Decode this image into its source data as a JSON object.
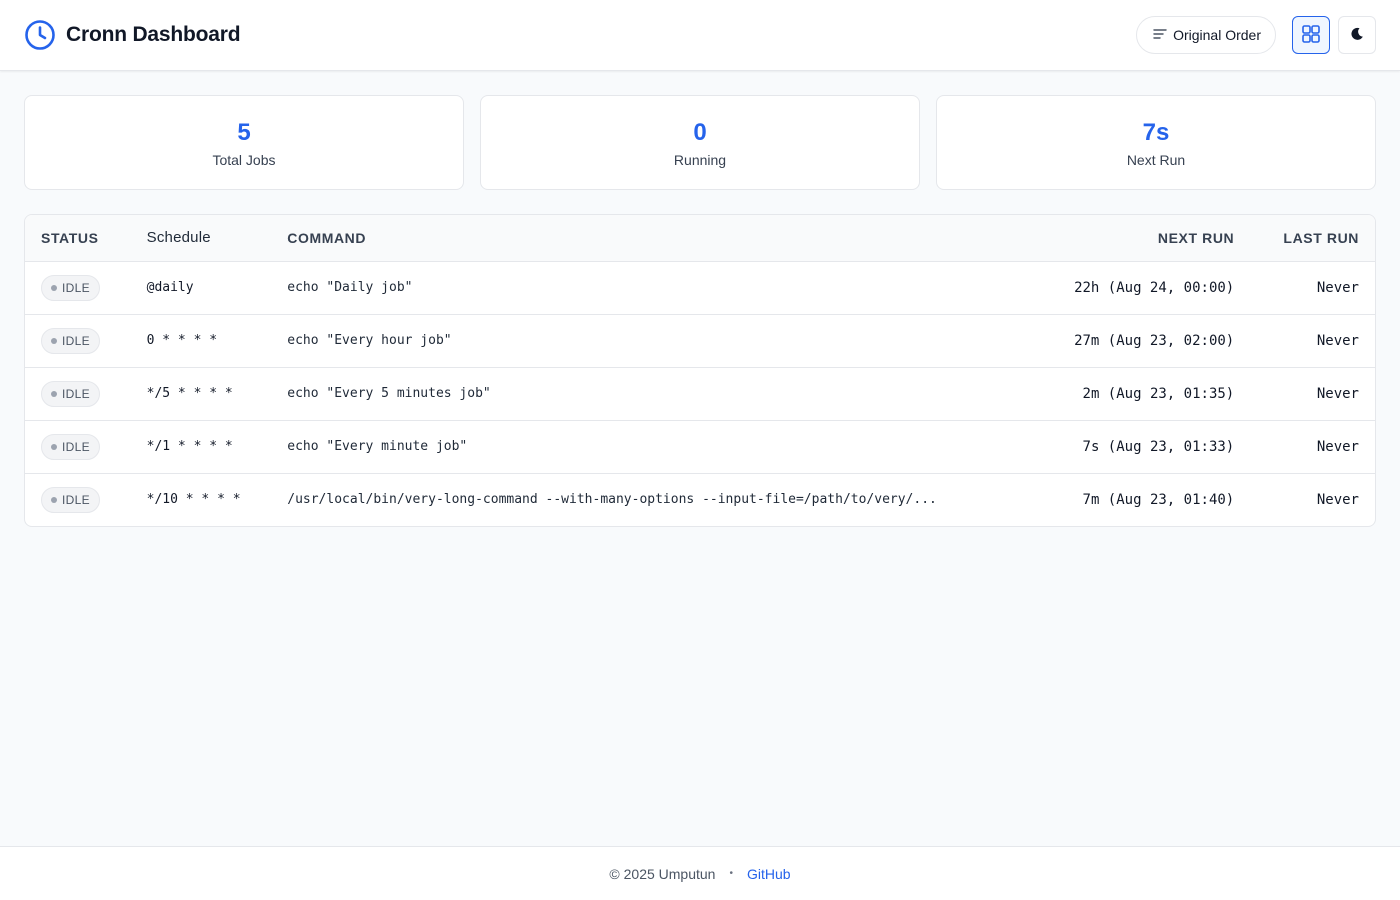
{
  "header": {
    "title": "Cronn Dashboard",
    "logo_icon": "clock-icon",
    "sort_label": "Original Order",
    "accent": "#2563eb"
  },
  "stats": [
    {
      "value": "5",
      "label": "Total Jobs"
    },
    {
      "value": "0",
      "label": "Running"
    },
    {
      "value": "7s",
      "label": "Next Run"
    }
  ],
  "table": {
    "headers": {
      "status": "STATUS",
      "schedule": "Schedule",
      "command": "COMMAND",
      "next_run": "NEXT RUN",
      "last_run": "LAST RUN"
    },
    "rows": [
      {
        "status": "IDLE",
        "schedule": "@daily",
        "command": "echo \"Daily job\"",
        "next_run": "22h (Aug 24, 00:00)",
        "last_run": "Never"
      },
      {
        "status": "IDLE",
        "schedule": "0 * * * *",
        "command": "echo \"Every hour job\"",
        "next_run": "27m (Aug 23, 02:00)",
        "last_run": "Never"
      },
      {
        "status": "IDLE",
        "schedule": "*/5 * * * *",
        "command": "echo \"Every 5 minutes job\"",
        "next_run": "2m (Aug 23, 01:35)",
        "last_run": "Never"
      },
      {
        "status": "IDLE",
        "schedule": "*/1 * * * *",
        "command": "echo \"Every minute job\"",
        "next_run": "7s (Aug 23, 01:33)",
        "last_run": "Never"
      },
      {
        "status": "IDLE",
        "schedule": "*/10 * * * *",
        "command": "/usr/local/bin/very-long-command --with-many-options --input-file=/path/to/very/...",
        "next_run": "7m (Aug 23, 01:40)",
        "last_run": "Never"
      }
    ]
  },
  "footer": {
    "copyright": "© 2025 Umputun",
    "separator": "•",
    "link_label": "GitHub"
  }
}
